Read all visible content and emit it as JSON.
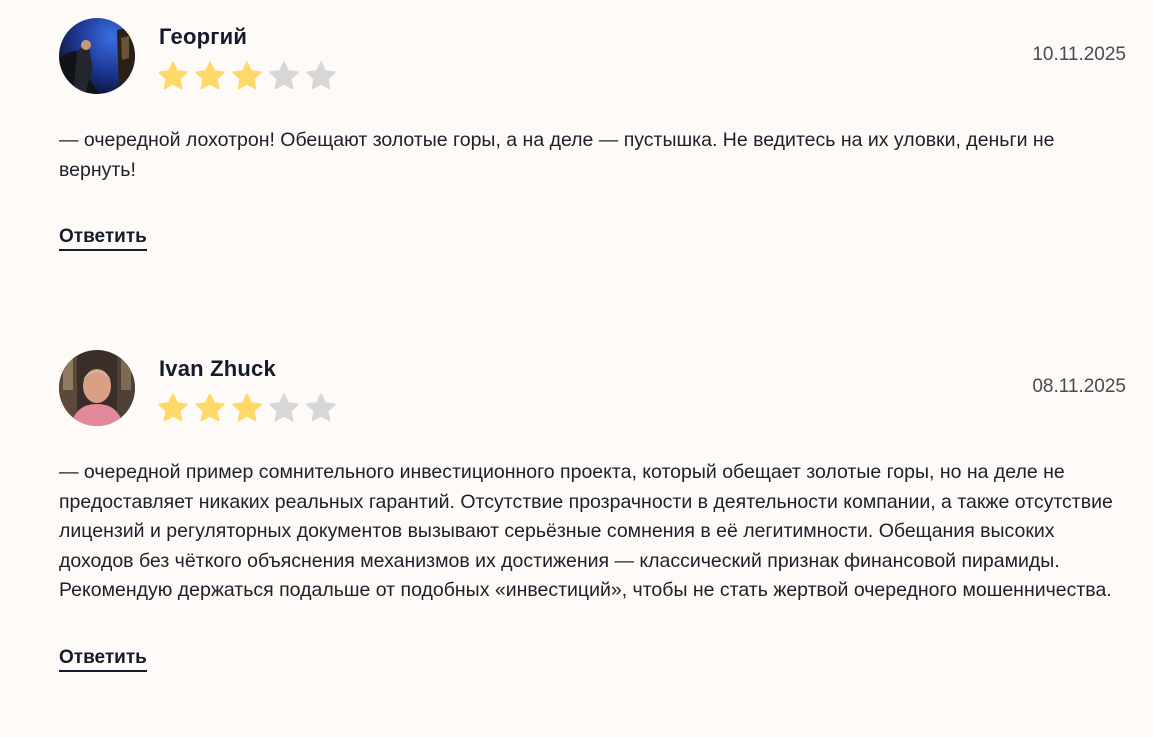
{
  "colors": {
    "star_filled": "#ffd86a",
    "star_empty": "#d7d7d7",
    "background": "#fdfaf7",
    "text": "#1f1f29"
  },
  "reviews": [
    {
      "author": "Георгий",
      "date": "10.11.2025",
      "rating": 3,
      "rating_max": 5,
      "text": "— очередной лохотрон! Обещают золотые горы, а на деле — пустышка. Не ведитесь на их уловки, деньги не вернуть!",
      "reply_label": "Ответить"
    },
    {
      "author": "Ivan Zhuck",
      "date": "08.11.2025",
      "rating": 3,
      "rating_max": 5,
      "text": "— очередной пример сомнительного инвестиционного проекта, который обещает золотые горы, но на деле не предоставляет никаких реальных гарантий. Отсутствие прозрачности в деятельности компании, а также отсутствие лицензий и регуляторных документов вызывают серьёзные сомнения в её легитимности. Обещания высоких доходов без чёткого объяснения механизмов их достижения — классический признак финансовой пирамиды. Рекомендую держаться подальше от подобных «инвестиций», чтобы не стать жертвой очередного мошенничества.",
      "reply_label": "Ответить"
    }
  ]
}
